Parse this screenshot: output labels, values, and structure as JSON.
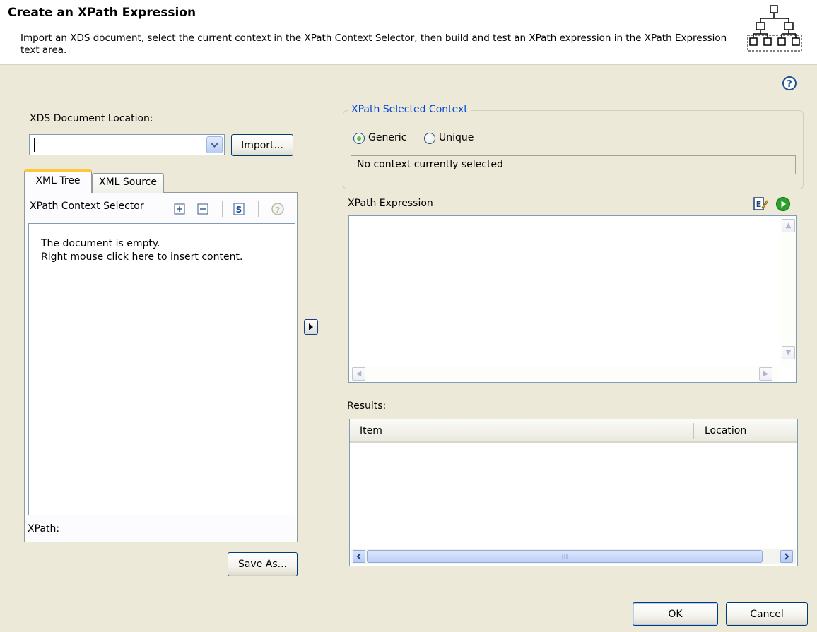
{
  "header": {
    "title": "Create an XPath Expression",
    "description": "Import an XDS document, select the current context in the XPath Context Selector, then build and test an XPath expression in the XPath Expression text area."
  },
  "left": {
    "xds_label": "XDS Document Location:",
    "xds_value": "",
    "import_label": "Import...",
    "tabs": [
      "XML Tree",
      "XML Source"
    ],
    "context_selector_label": "XPath Context Selector",
    "empty_line1": "The document is empty.",
    "empty_line2": "Right mouse click here to insert content.",
    "xpath_label": "XPath:",
    "save_as_label": "Save As..."
  },
  "context": {
    "legend": "XPath Selected Context",
    "options": [
      "Generic",
      "Unique"
    ],
    "selected": "Generic",
    "status": "No context currently selected"
  },
  "expression": {
    "label": "XPath Expression",
    "value": ""
  },
  "results": {
    "label": "Results:",
    "columns": [
      "Item",
      "Location"
    ]
  },
  "buttons": {
    "ok": "OK",
    "cancel": "Cancel"
  },
  "colors": {
    "background": "#ece9d8",
    "accent_blue": "#0046d5",
    "tab_highlight": "#ffc83c",
    "run_green": "#2aa12a"
  }
}
